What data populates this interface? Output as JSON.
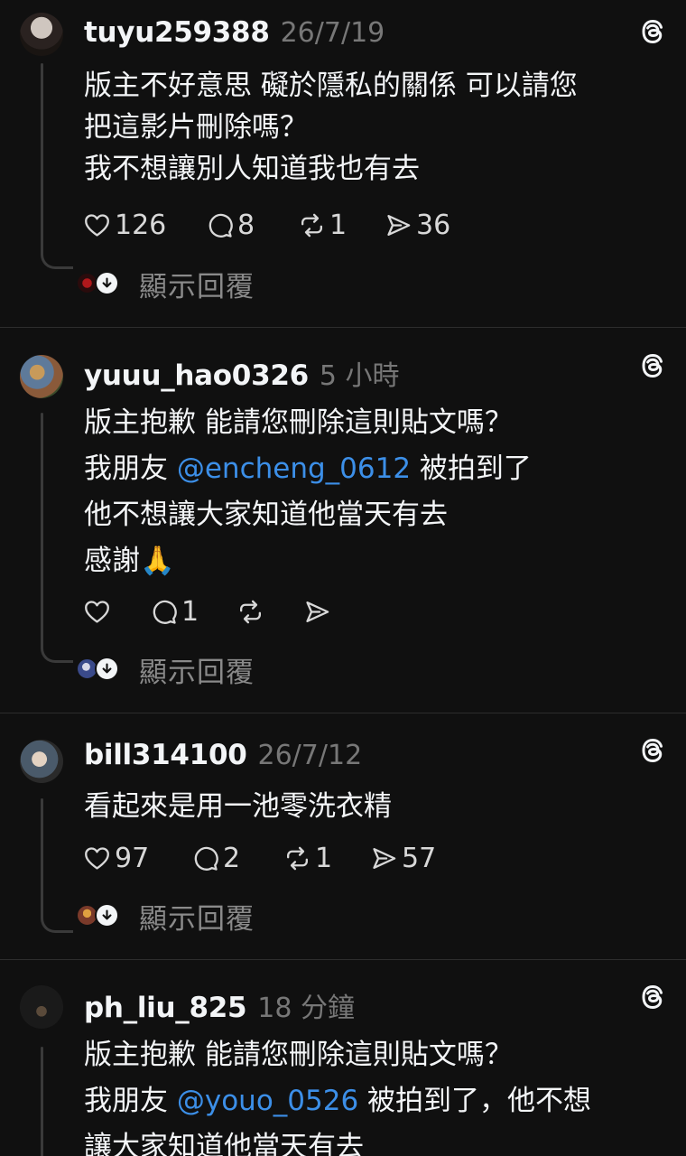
{
  "comments": [
    {
      "username": "tuyu259388",
      "time": "26/7/19",
      "lines": [
        "版主不好意思 礙於隱私的關係 可以請您",
        "把這影片刪除嗎？",
        "我不想讓別人知道我也有去"
      ],
      "likes": "126",
      "replies": "8",
      "reposts": "1",
      "shares": "36",
      "show_replies": "顯示回覆"
    },
    {
      "username": "yuuu_hao0326",
      "time": "5 小時",
      "line1": "版主抱歉 能請您刪除這則貼文嗎？",
      "line2_prefix": "我朋友 ",
      "line2_mention": "@encheng_0612",
      "line2_suffix": " 被拍到了",
      "line3": "他不想讓大家知道他當天有去",
      "line4_text": "感謝",
      "line4_emoji": "🙏",
      "likes": "",
      "replies": "1",
      "reposts": "",
      "shares": "",
      "show_replies": "顯示回覆"
    },
    {
      "username": "bill314100",
      "time": "26/7/12",
      "line1": "看起來是用一池零洗衣精",
      "likes": "97",
      "replies": "2",
      "reposts": "1",
      "shares": "57",
      "show_replies": "顯示回覆"
    },
    {
      "username": "ph_liu_825",
      "time": "18 分鐘",
      "line1": "版主抱歉 能請您刪除這則貼文嗎？",
      "line2_prefix": "我朋友 ",
      "line2_mention": "@youo_0526",
      "line2_suffix": " 被拍到了，他不想",
      "line3": "讓大家知道他當天有去"
    }
  ],
  "icons": {
    "like": "heart-icon",
    "reply": "comment-icon",
    "repost": "repost-icon",
    "share": "send-icon",
    "threads": "threads-logo-icon",
    "expand": "arrow-down-icon"
  },
  "colors": {
    "background": "#101010",
    "mention": "#3c8fe8",
    "muted": "#777777"
  }
}
